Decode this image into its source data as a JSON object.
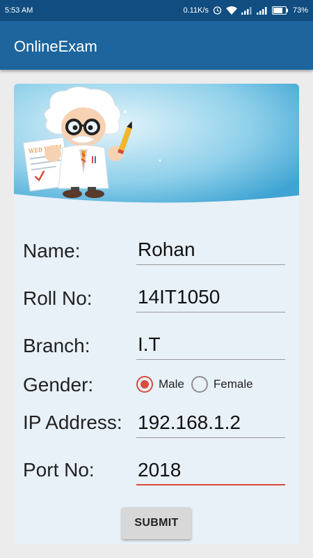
{
  "status_bar": {
    "time": "5:53 AM",
    "speed": "0.11K/s",
    "battery": "73%",
    "icons": [
      "alarm-icon",
      "wifi-icon",
      "signal-icon",
      "signal-icon",
      "battery-icon"
    ]
  },
  "app_bar": {
    "title": "OnlineExam"
  },
  "banner": {
    "paper_text": "WEB EXAM",
    "icon": "professor-illustration"
  },
  "form": {
    "name": {
      "label": "Name:",
      "value": "Rohan"
    },
    "roll": {
      "label": "Roll No:",
      "value": "14IT1050"
    },
    "branch": {
      "label": "Branch:",
      "value": "I.T"
    },
    "gender": {
      "label": "Gender:",
      "options": [
        "Male",
        "Female"
      ],
      "selected": "Male"
    },
    "ip": {
      "label": "IP Address:",
      "value": "192.168.1.2"
    },
    "port": {
      "label": "Port No:",
      "value": "2018"
    },
    "submit_label": "SUBMIT"
  },
  "colors": {
    "primary": "#1d659c",
    "status_bar": "#114d80",
    "accent": "#d84c3c",
    "card": "#e8f0f8"
  }
}
